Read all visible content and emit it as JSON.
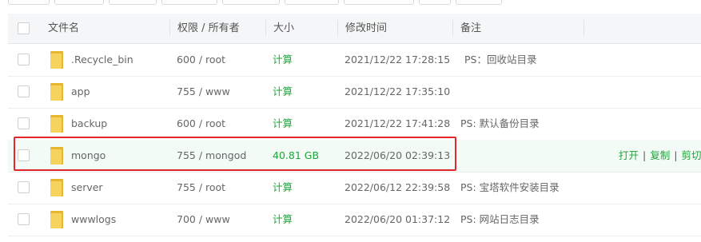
{
  "table": {
    "headers": {
      "name": "文件名",
      "permission": "权限 / 所有者",
      "size": "大小",
      "mtime": "修改时间",
      "remark": "备注"
    },
    "rows": [
      {
        "name": ".Recycle_bin",
        "permission": "600 / root",
        "size": "计算",
        "mtime": "2021/12/22 17:28:15",
        "remark": "PS：回收站目录"
      },
      {
        "name": "app",
        "permission": "755 / www",
        "size": "计算",
        "mtime": "2021/12/22 17:35:10",
        "remark": ""
      },
      {
        "name": "backup",
        "permission": "600 / root",
        "size": "计算",
        "mtime": "2021/12/22 17:41:28",
        "remark": "PS: 默认备份目录"
      },
      {
        "name": "mongo",
        "permission": "755 / mongod",
        "size": "40.81 GB",
        "mtime": "2022/06/20 02:39:13",
        "remark": "",
        "actions": {
          "open": "打开",
          "copy": "复制",
          "cut": "剪切"
        }
      },
      {
        "name": "server",
        "permission": "755 / root",
        "size": "计算",
        "mtime": "2022/06/12 22:39:58",
        "remark": "PS: 宝塔软件安装目录"
      },
      {
        "name": "wwwlogs",
        "permission": "700 / www",
        "size": "计算",
        "mtime": "2022/06/20 01:37:12",
        "remark": "PS: 网站日志目录"
      }
    ]
  },
  "colors": {
    "accent": "#20a53a",
    "highlight_row": "#f2fbf5",
    "annotation": "#e5262b",
    "folder": "#f6d35c"
  }
}
